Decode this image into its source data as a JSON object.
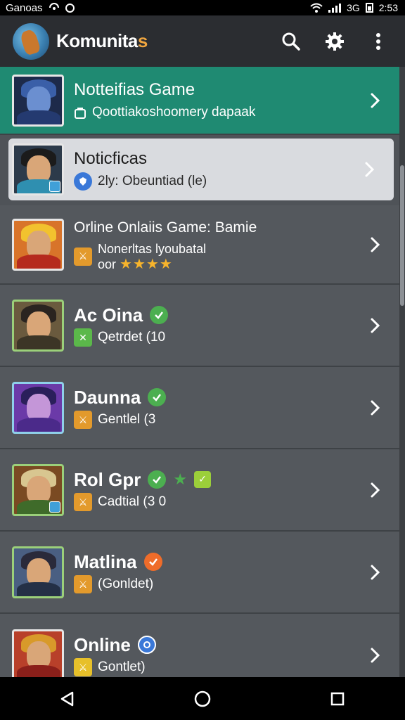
{
  "status_bar": {
    "carrier": "Ganoas",
    "signal_text": "3G",
    "time": "2:53",
    "icons": [
      "location-icon",
      "notification-icon",
      "wifi-icon",
      "signal-icon",
      "battery-icon"
    ]
  },
  "app_bar": {
    "title_main": "Komunita",
    "title_accent": "s",
    "actions": [
      "search-icon",
      "settings-icon",
      "overflow-menu-icon"
    ]
  },
  "colors": {
    "featured_bg": "#1f8a72",
    "selected_bg": "#d9dbdf",
    "row_bg": "#54585d",
    "accent_orange": "#f0a640",
    "check_green": "#4caf50",
    "star": "#f7b42c"
  },
  "list": [
    {
      "id": "featured",
      "title": "Notteifias Game",
      "subtitle": "Qoottiakoshoomery dapaak",
      "badge_icon": "bag-icon"
    },
    {
      "id": "selected",
      "title": "Noticficas",
      "subtitle": "2ly: Obeuntiad (le)",
      "badge_icon": "shield-icon"
    },
    {
      "id": "online-game",
      "title": "Orline Onlaiis Game: Bamie",
      "subtitle": "Nonerltas lyoubatal",
      "rating_prefix": "oor",
      "stars": "★★★★",
      "rating": 4,
      "badge_icon": "sword-icon"
    },
    {
      "id": "ac-oina",
      "title": "Ac Oina",
      "subtitle": "Qetrdet (10",
      "status_icon": "check-circle-icon",
      "badge_icon": "sword-icon"
    },
    {
      "id": "daunna",
      "title": "Daunna",
      "subtitle": "Gentlel (3",
      "status_icon": "check-circle-icon",
      "badge_icon": "sword-icon"
    },
    {
      "id": "rol-gpr",
      "title": "Rol Gpr",
      "subtitle": "Cadtial (3 0",
      "status_icon": "check-circle-icon",
      "badge_icon": "sword-icon"
    },
    {
      "id": "matlina",
      "title": "Matlina",
      "subtitle": "(Gonldet)",
      "status_icon": "orange-check-icon",
      "badge_icon": "sword-icon"
    },
    {
      "id": "online",
      "title": "Online",
      "subtitle": "Gontlet)",
      "status_icon": "blue-circle-icon",
      "badge_icon": "sword-icon"
    }
  ],
  "nav_bar": [
    "back-icon",
    "home-icon",
    "recents-icon"
  ]
}
